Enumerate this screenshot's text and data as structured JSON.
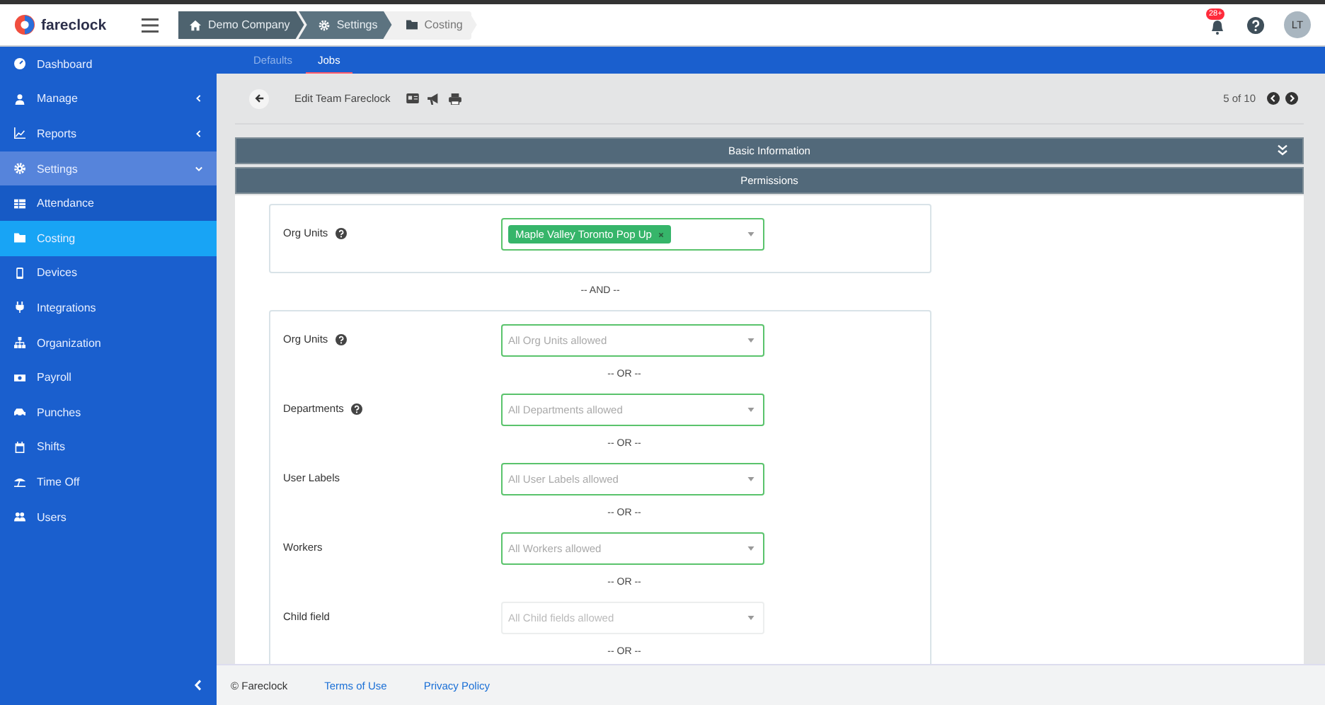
{
  "header": {
    "logo": "fareclock",
    "breadcrumbs": [
      {
        "label": "Demo Company",
        "current": false
      },
      {
        "label": "Settings",
        "current": false
      },
      {
        "label": "Costing",
        "current": true
      }
    ],
    "notification_badge": "28+",
    "avatar": "LT"
  },
  "sidebar": {
    "items": [
      {
        "label": "Dashboard",
        "kind": "link",
        "selected": false
      },
      {
        "label": "Manage",
        "kind": "group",
        "expanded": false,
        "selected": false
      },
      {
        "label": "Reports",
        "kind": "group",
        "expanded": false,
        "selected": false
      },
      {
        "label": "Settings",
        "kind": "group",
        "expanded": true,
        "selected": false
      },
      {
        "label": "Attendance",
        "kind": "sub",
        "selected": false
      },
      {
        "label": "Costing",
        "kind": "sub",
        "selected": true
      },
      {
        "label": "Devices",
        "kind": "link",
        "selected": false
      },
      {
        "label": "Integrations",
        "kind": "link",
        "selected": false
      },
      {
        "label": "Organization",
        "kind": "link",
        "selected": false
      },
      {
        "label": "Payroll",
        "kind": "link",
        "selected": false
      },
      {
        "label": "Punches",
        "kind": "link",
        "selected": false
      },
      {
        "label": "Shifts",
        "kind": "link",
        "selected": false
      },
      {
        "label": "Time Off",
        "kind": "link",
        "selected": false
      },
      {
        "label": "Users",
        "kind": "link",
        "selected": false
      }
    ]
  },
  "tabs": [
    {
      "label": "Defaults",
      "selected": false
    },
    {
      "label": "Jobs",
      "selected": true
    }
  ],
  "toolbar": {
    "title": "Edit Team Fareclock",
    "pager": "5 of 10"
  },
  "sections": [
    {
      "title": "Basic Information",
      "expanded": false
    },
    {
      "title": "Permissions",
      "expanded": true
    }
  ],
  "permissions": [
    {
      "kind": "card",
      "items": [
        {
          "kind": "field",
          "label": "Org Units",
          "help": true,
          "disabled": false,
          "tags": [
            "Maple Valley Toronto Pop Up"
          ]
        }
      ]
    },
    {
      "kind": "separator",
      "text": "-- AND --"
    },
    {
      "kind": "card",
      "items": [
        {
          "kind": "field",
          "label": "Org Units",
          "help": true,
          "disabled": false,
          "placeholder": "All Org Units allowed"
        },
        {
          "kind": "separator",
          "text": "-- OR --"
        },
        {
          "kind": "field",
          "label": "Departments",
          "help": true,
          "disabled": false,
          "placeholder": "All Departments allowed"
        },
        {
          "kind": "separator",
          "text": "-- OR --"
        },
        {
          "kind": "field",
          "label": "User Labels",
          "help": false,
          "disabled": false,
          "placeholder": "All User Labels allowed"
        },
        {
          "kind": "separator",
          "text": "-- OR --"
        },
        {
          "kind": "field",
          "label": "Workers",
          "help": false,
          "disabled": false,
          "placeholder": "All Workers allowed"
        },
        {
          "kind": "separator",
          "text": "-- OR --"
        },
        {
          "kind": "field",
          "label": "Child field",
          "help": false,
          "disabled": true,
          "placeholder": "All Child fields allowed"
        },
        {
          "kind": "separator",
          "text": "-- OR --"
        }
      ]
    }
  ],
  "footer": {
    "copyright": "© Fareclock",
    "links": [
      "Terms of Use",
      "Privacy Policy"
    ]
  }
}
